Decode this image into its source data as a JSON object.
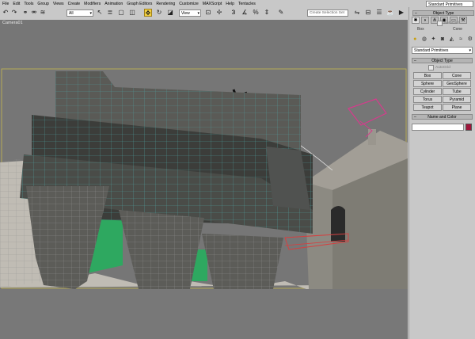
{
  "menu": [
    "File",
    "Edit",
    "Tools",
    "Group",
    "Views",
    "Create",
    "Modifiers",
    "Animation",
    "Graph Editors",
    "Rendering",
    "Customize",
    "MAXScript",
    "Help",
    "Tentacles"
  ],
  "header_right_field": "Standard Primitives",
  "toolbar": {
    "selection_filter": "All",
    "ref_coord": "View",
    "named_selection_placeholder": "Create Selection Set"
  },
  "viewport": {
    "label": "Camera01"
  },
  "command_panel": {
    "small_rollout": "Object Type",
    "small_autogrid": "AutoGrid",
    "small_buttons": [
      "Box",
      "Cone"
    ],
    "category_dropdown": "Standard Primitives",
    "object_type_title": "Object Type",
    "autogrid": "AutoGrid",
    "primitives": [
      "Box",
      "Cone",
      "Sphere",
      "GeoSphere",
      "Cylinder",
      "Tube",
      "Torus",
      "Pyramid",
      "Teapot",
      "Plane"
    ],
    "name_color_title": "Name and Color",
    "object_name": "",
    "object_color": "#a0143a"
  },
  "icons": [
    "undo-icon",
    "redo-icon",
    "select-link-icon",
    "unlink-icon",
    "bind-spacewarp-icon",
    "select-object-icon",
    "select-region-icon",
    "select-by-name-icon",
    "select-move-icon",
    "select-rotate-icon",
    "select-scale-icon",
    "mirror-icon",
    "align-icon",
    "render-icon",
    "quick-render-icon",
    "create-tab-icon",
    "modify-tab-icon",
    "hierarchy-tab-icon",
    "motion-tab-icon",
    "display-tab-icon",
    "utilities-tab-icon",
    "geometry-icon",
    "shapes-icon",
    "lights-icon",
    "cameras-icon",
    "helpers-icon",
    "spacewarps-icon",
    "systems-icon"
  ]
}
